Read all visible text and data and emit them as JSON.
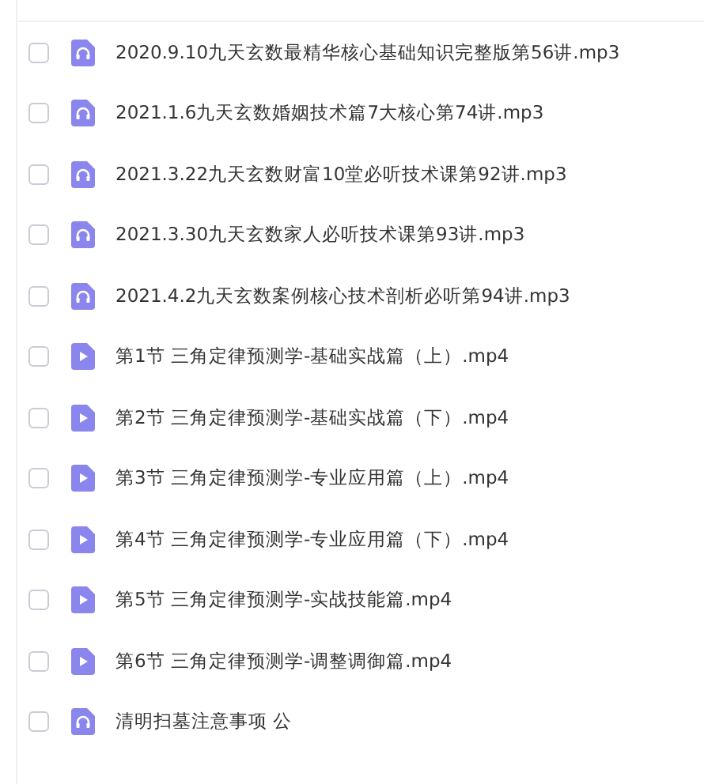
{
  "files": [
    {
      "kind": "audio",
      "name": "2020.9.10九天玄数最精华核心基础知识完整版第56讲.mp3",
      "checked": false
    },
    {
      "kind": "audio",
      "name": "2021.1.6九天玄数婚姻技术篇7大核心第74讲.mp3",
      "checked": false
    },
    {
      "kind": "audio",
      "name": "2021.3.22九天玄数财富10堂必听技术课第92讲.mp3",
      "checked": false
    },
    {
      "kind": "audio",
      "name": "2021.3.30九天玄数家人必听技术课第93讲.mp3",
      "checked": false
    },
    {
      "kind": "audio",
      "name": "2021.4.2九天玄数案例核心技术剖析必听第94讲.mp3",
      "checked": false
    },
    {
      "kind": "video",
      "name": "第1节 三角定律预测学-基础实战篇（上）.mp4",
      "checked": false
    },
    {
      "kind": "video",
      "name": "第2节 三角定律预测学-基础实战篇（下）.mp4",
      "checked": false
    },
    {
      "kind": "video",
      "name": "第3节 三角定律预测学-专业应用篇（上）.mp4",
      "checked": false
    },
    {
      "kind": "video",
      "name": "第4节 三角定律预测学-专业应用篇（下）.mp4",
      "checked": false
    },
    {
      "kind": "video",
      "name": "第5节 三角定律预测学-实战技能篇.mp4",
      "checked": false
    },
    {
      "kind": "video",
      "name": "第6节 三角定律预测学-调整调御篇.mp4",
      "checked": false
    },
    {
      "kind": "audio",
      "name": "清明扫墓注意事项 公",
      "checked": false
    }
  ]
}
